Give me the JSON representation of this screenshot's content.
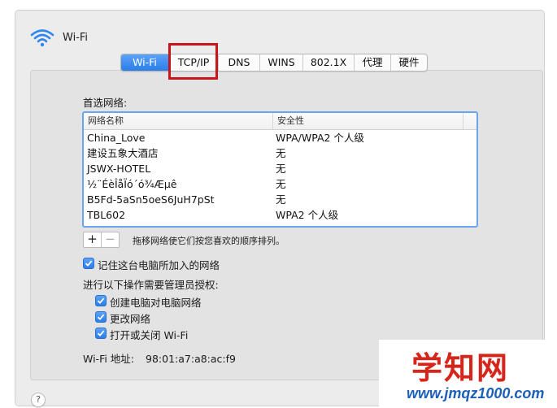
{
  "header": {
    "title": "Wi-Fi",
    "icon": "wifi-icon"
  },
  "tabs": [
    {
      "label": "Wi-Fi",
      "active": true
    },
    {
      "label": "TCP/IP",
      "active": false
    },
    {
      "label": "DNS",
      "active": false
    },
    {
      "label": "WINS",
      "active": false
    },
    {
      "label": "802.1X",
      "active": false
    },
    {
      "label": "代理",
      "active": false
    },
    {
      "label": "硬件",
      "active": false
    }
  ],
  "preferred": {
    "label": "首选网络:",
    "columns": [
      "网络名称",
      "安全性"
    ],
    "rows": [
      [
        "China_Love",
        "WPA/WPA2 个人级"
      ],
      [
        "建设五象大酒店",
        "无"
      ],
      [
        "JSWX-HOTEL",
        "无"
      ],
      [
        "½¨ÉèÎåÏó´ó¾Æµê",
        "无"
      ],
      [
        "B5Fd-5aSn5oeS6JuH7pSt",
        "无"
      ],
      [
        "TBL602",
        "WPA2 个人级"
      ]
    ],
    "add_label": "+",
    "remove_label": "−",
    "hint": "拖移网络使它们按您喜欢的顺序排列。"
  },
  "remember": {
    "label": "记住这台电脑所加入的网络",
    "checked": true
  },
  "admin": {
    "label": "进行以下操作需要管理员授权:",
    "items": [
      {
        "label": "创建电脑对电脑网络",
        "checked": true
      },
      {
        "label": "更改网络",
        "checked": true
      },
      {
        "label": "打开或关闭 Wi-Fi",
        "checked": true
      }
    ]
  },
  "address": {
    "label": "Wi-Fi 地址:",
    "value": "98:01:a7:a8:ac:f9"
  },
  "help": {
    "label": "?"
  },
  "watermark": {
    "text": "学知网",
    "url": "www.jmqz1000.com"
  },
  "colors": {
    "accent": "#2b7de9",
    "highlight": "#c8151b",
    "watermark_red": "#d6261c",
    "watermark_blue": "#1c5fb8"
  }
}
